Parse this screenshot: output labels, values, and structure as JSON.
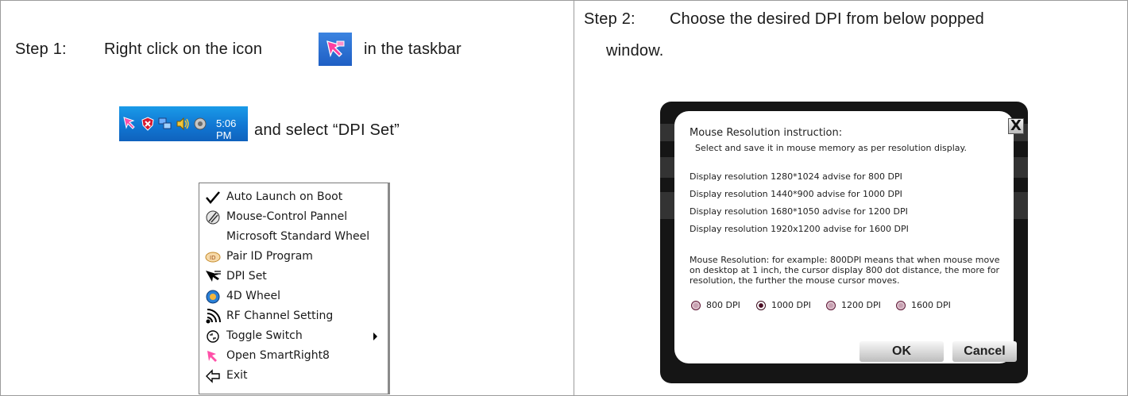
{
  "step1": {
    "label": "Step 1:",
    "text": "Right click on the icon",
    "text_after": "in the taskbar",
    "select_text": "and select “DPI Set”"
  },
  "taskbar": {
    "time": "5:06 PM",
    "icons": [
      "smartright-icon",
      "shield-icon",
      "network-icon",
      "volume-icon",
      "speaker-icon"
    ]
  },
  "context_menu": {
    "items": [
      {
        "label": "Auto Launch on Boot",
        "icon": "checkmark-icon"
      },
      {
        "label": "Mouse-Control Pannel",
        "icon": "mouse-control-icon"
      },
      {
        "label": "Microsoft Standard Wheel",
        "icon": ""
      },
      {
        "label": "Pair ID Program",
        "icon": "pair-id-icon"
      },
      {
        "label": "DPI Set",
        "icon": "dpi-cursor-icon"
      },
      {
        "label": "4D Wheel",
        "icon": "wheel-icon"
      },
      {
        "label": "RF Channel Setting",
        "icon": "rf-signal-icon"
      },
      {
        "label": "Toggle Switch",
        "icon": "toggle-icon",
        "submenu": true
      },
      {
        "label": "Open SmartRight8",
        "icon": "smartright-icon"
      },
      {
        "label": "Exit",
        "icon": "exit-icon"
      }
    ]
  },
  "step2": {
    "label": "Step 2:",
    "text": "Choose the desired DPI from below popped",
    "text_line2": "window."
  },
  "dialog": {
    "title": "Mouse Resolution instruction:",
    "subtitle": "Select and save it in mouse memory as per resolution display.",
    "resolutions": [
      "Display resolution 1280*1024 advise for  800 DPI",
      "Display resolution 1440*900  advise for 1000 DPI",
      "Display resolution 1680*1050 advise for 1200 DPI",
      "Display resolution 1920x1200 advise for 1600 DPI"
    ],
    "explanation": [
      "Mouse Resolution: for example: 800DPI means that when mouse move",
      "on desktop at 1 inch, the cursor display 800 dot distance, the more for",
      "resolution, the further the mouse cursor moves."
    ],
    "dpi_options": [
      "800 DPI",
      "1000 DPI",
      "1200 DPI",
      "1600 DPI"
    ],
    "selected_dpi": "1000 DPI",
    "ok_label": "OK",
    "cancel_label": "Cancel",
    "close_label": "X"
  },
  "colors": {
    "taskbar": "#1177d3",
    "dialog_frame": "#151515",
    "radio_selected": "#4a0b22",
    "panel_border": "#9c9c9c"
  }
}
